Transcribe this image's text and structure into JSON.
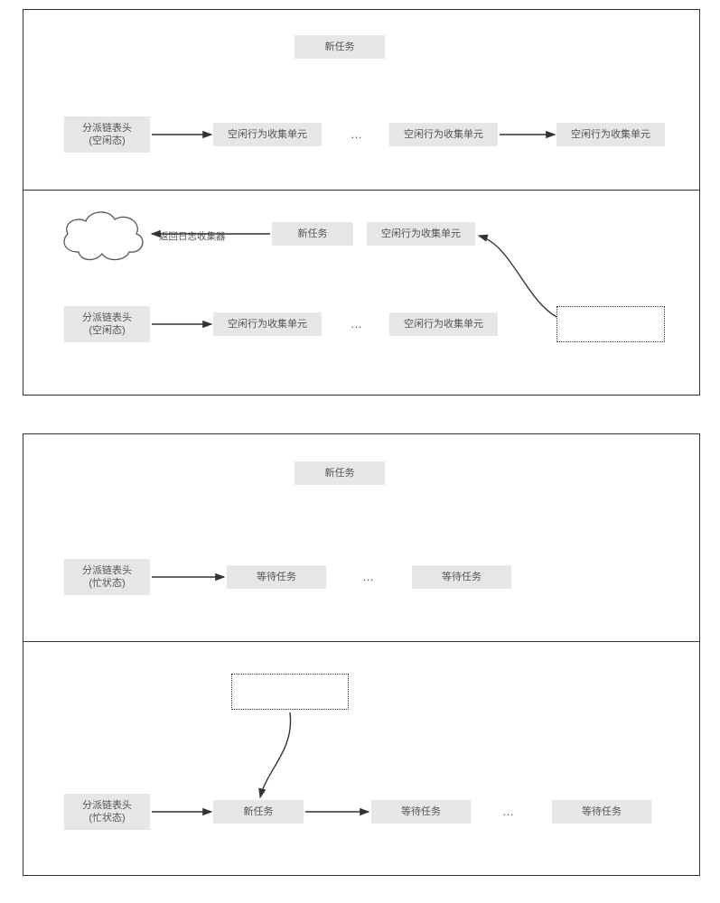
{
  "labels": {
    "new_task": "新任务",
    "dispatch_head_idle": "分派链表头\n(空闲态)",
    "dispatch_head_busy": "分派链表头\n(忙状态)",
    "idle_collect_unit": "空闲行为收集单元",
    "waiting_task": "等待任务",
    "return_log_collector": "返回日志收集器"
  },
  "chart_data": {
    "type": "diagram",
    "title": "",
    "sections": [
      {
        "id": "section-1",
        "panels": [
          {
            "id": "panel-1a",
            "elements": [
              "新任务",
              "分派链表头(空闲态)",
              "空闲行为收集单元",
              "…",
              "空闲行为收集单元",
              "空闲行为收集单元"
            ],
            "arrows": [
              "分派链表头→空闲行为收集单元",
              "空闲行为收集单元→空闲行为收集单元"
            ]
          },
          {
            "id": "panel-1b",
            "elements": [
              "返回日志收集器(cloud)",
              "新任务",
              "空闲行为收集单元",
              "虚线占位",
              "分派链表头(空闲态)",
              "空闲行为收集单元",
              "…",
              "空闲行为收集单元"
            ],
            "arrows": [
              "新任务←返回日志收集器",
              "虚线占位→空闲行为收集单元(curve)",
              "分派链表头→空闲行为收集单元"
            ]
          }
        ]
      },
      {
        "id": "section-2",
        "panels": [
          {
            "id": "panel-2a",
            "elements": [
              "新任务",
              "分派链表头(忙状态)",
              "等待任务",
              "…",
              "等待任务"
            ],
            "arrows": [
              "分派链表头→等待任务"
            ]
          },
          {
            "id": "panel-2b",
            "elements": [
              "虚线占位",
              "分派链表头(忙状态)",
              "新任务",
              "等待任务",
              "…",
              "等待任务"
            ],
            "arrows": [
              "虚线占位→新任务(curve)",
              "分派链表头→新任务",
              "新任务→等待任务"
            ]
          }
        ]
      }
    ]
  }
}
